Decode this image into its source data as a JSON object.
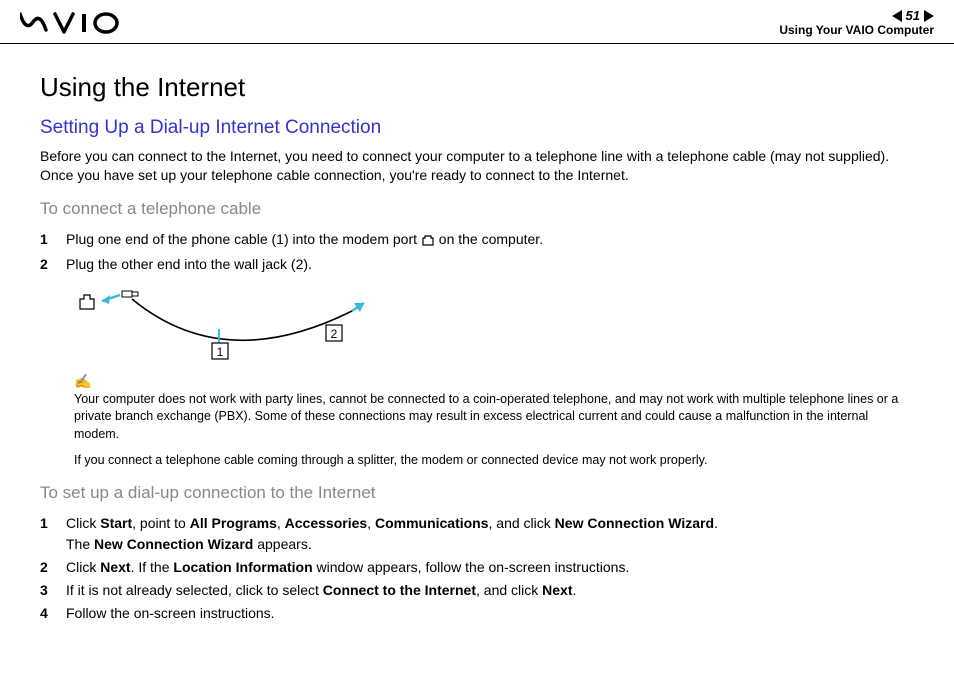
{
  "header": {
    "page_number": "51",
    "section": "Using Your VAIO Computer"
  },
  "title": "Using the Internet",
  "subtitle": "Setting Up a Dial-up Internet Connection",
  "intro": "Before you can connect to the Internet, you need to connect your computer to a telephone line with a telephone cable (may not supplied). Once you have set up your telephone cable connection, you're ready to connect to the Internet.",
  "sectionA": {
    "heading": "To connect a telephone cable",
    "steps": [
      {
        "num": "1",
        "pre": "Plug one end of the phone cable (1) into the modem port ",
        "post": " on the computer."
      },
      {
        "num": "2",
        "text": "Plug the other end into the wall jack (2)."
      }
    ],
    "diagram": {
      "label1": "1",
      "label2": "2"
    },
    "note": "Your computer does not work with party lines, cannot be connected to a coin-operated telephone, and may not work with multiple telephone lines or a private branch exchange (PBX). Some of these connections may result in excess electrical current and could cause a malfunction in the internal modem.",
    "note2": "If you connect a telephone cable coming through a splitter, the modem or connected device may not work properly."
  },
  "sectionB": {
    "heading": "To set up a dial-up connection to the Internet",
    "steps": [
      {
        "num": "1",
        "parts": [
          "Click ",
          "Start",
          ", point to ",
          "All Programs",
          ", ",
          "Accessories",
          ", ",
          "Communications",
          ", and click ",
          "New Connection Wizard",
          "."
        ],
        "line2_parts": [
          "The ",
          "New Connection Wizard",
          " appears."
        ]
      },
      {
        "num": "2",
        "parts": [
          "Click ",
          "Next",
          ". If the ",
          "Location Information",
          " window appears, follow the on-screen instructions."
        ]
      },
      {
        "num": "3",
        "parts": [
          "If it is not already selected, click to select ",
          "Connect to the Internet",
          ", and click ",
          "Next",
          "."
        ]
      },
      {
        "num": "4",
        "parts": [
          "Follow the on-screen instructions."
        ]
      }
    ]
  }
}
